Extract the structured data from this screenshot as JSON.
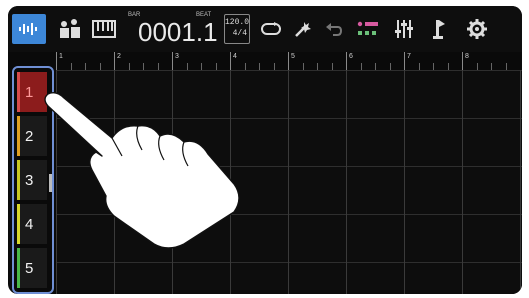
{
  "toolbar": {
    "counter": {
      "bar_label": "BAR",
      "beat_label": "BEAT",
      "value": "0001.1"
    },
    "tempo": {
      "bpm": "120.0",
      "signature": "4/4"
    }
  },
  "ruler": {
    "bars": [
      "1",
      "2",
      "3",
      "4",
      "5",
      "6",
      "7",
      "8"
    ]
  },
  "tracks": [
    {
      "label": "1",
      "color": "#d84a4a",
      "selected": true
    },
    {
      "label": "2",
      "color": "#e0a020"
    },
    {
      "label": "3",
      "color": "#c8c820"
    },
    {
      "label": "4",
      "color": "#d8d82a"
    },
    {
      "label": "5",
      "color": "#48b848"
    }
  ],
  "colors": {
    "accent": "#3d87d8",
    "selection_frame": "#6f8fd4",
    "background": "#0a0a0a"
  },
  "icons": [
    "track-view-icon",
    "drum-pads-icon",
    "keyboard-icon",
    "loop-icon",
    "effects-icon",
    "undo-icon",
    "edit-icon",
    "mixer-icon",
    "metronome-icon",
    "settings-icon",
    "pointing-hand-icon"
  ]
}
